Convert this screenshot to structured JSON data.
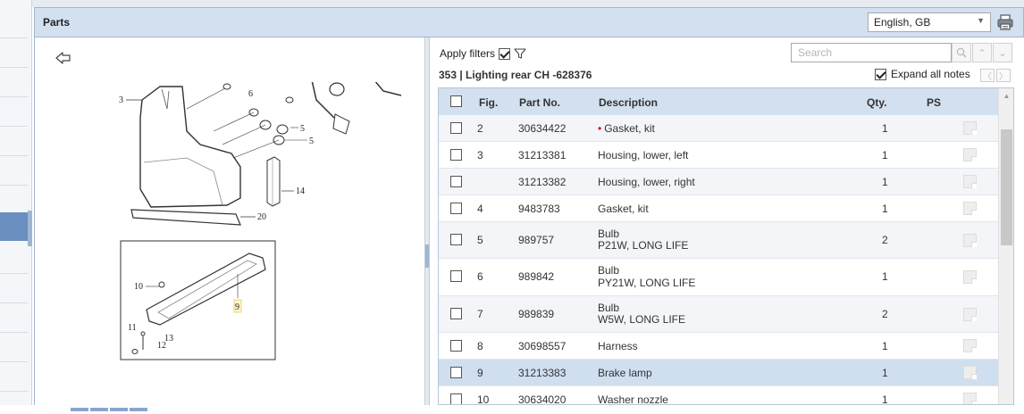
{
  "header": {
    "title": "Parts",
    "language": "English, GB",
    "print_icon": "printer-icon"
  },
  "filters": {
    "apply_label": "Apply filters",
    "apply_checked": true,
    "funnel_icon": "funnel-icon"
  },
  "search": {
    "placeholder": "Search"
  },
  "breadcrumb": "353  |  Lighting rear CH -628376",
  "expand_notes": {
    "label": "Expand all notes",
    "checked": true
  },
  "table": {
    "columns": {
      "fig": "Fig.",
      "part_no": "Part No.",
      "description": "Description",
      "qty": "Qty.",
      "ps": "PS"
    },
    "rows": [
      {
        "fig": "2",
        "part_no": "30634422",
        "description": "Gasket, kit",
        "sub": "",
        "qty": "1",
        "marker": true
      },
      {
        "fig": "3",
        "part_no": "31213381",
        "description": "Housing, lower, left",
        "sub": "",
        "qty": "1"
      },
      {
        "fig": "",
        "part_no": "31213382",
        "description": "Housing, lower, right",
        "sub": "",
        "qty": "1"
      },
      {
        "fig": "4",
        "part_no": "9483783",
        "description": "Gasket, kit",
        "sub": "",
        "qty": "1"
      },
      {
        "fig": "5",
        "part_no": "989757",
        "description": "Bulb",
        "sub": "P21W, LONG LIFE",
        "qty": "2"
      },
      {
        "fig": "6",
        "part_no": "989842",
        "description": "Bulb",
        "sub": "PY21W, LONG LIFE",
        "qty": "1"
      },
      {
        "fig": "7",
        "part_no": "989839",
        "description": "Bulb",
        "sub": "W5W, LONG LIFE",
        "qty": "2"
      },
      {
        "fig": "8",
        "part_no": "30698557",
        "description": "Harness",
        "sub": "",
        "qty": "1"
      },
      {
        "fig": "9",
        "part_no": "31213383",
        "description": "Brake lamp",
        "sub": "",
        "qty": "1",
        "selected": true
      },
      {
        "fig": "10",
        "part_no": "30634020",
        "description": "Washer nozzle",
        "sub": "",
        "qty": "1"
      }
    ]
  },
  "diagram": {
    "callouts": [
      "3",
      "6",
      "5",
      "5",
      "14",
      "20",
      "10",
      "9",
      "11",
      "13",
      "12"
    ]
  },
  "colors": {
    "header_bg": "#d3e0ef",
    "selected_row": "#cfdff0",
    "accent": "#6a8fbf"
  }
}
